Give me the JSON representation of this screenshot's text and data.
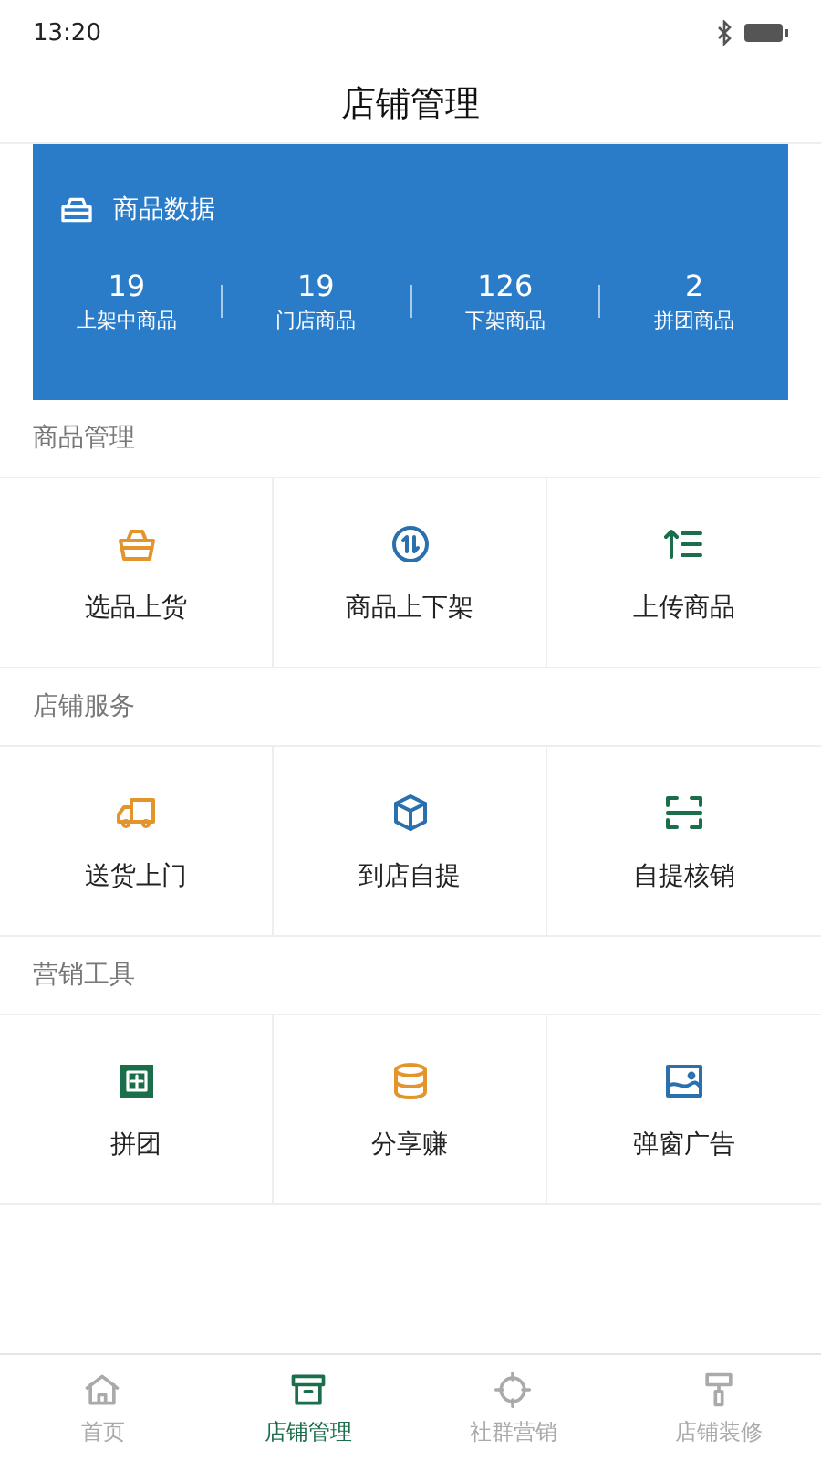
{
  "status_bar": {
    "time": "13:20"
  },
  "header": {
    "title": "店铺管理"
  },
  "stats_card": {
    "title": "商品数据",
    "stats": [
      {
        "value": "19",
        "label": "上架中商品"
      },
      {
        "value": "19",
        "label": "门店商品"
      },
      {
        "value": "126",
        "label": "下架商品"
      },
      {
        "value": "2",
        "label": "拼团商品"
      }
    ]
  },
  "sections": [
    {
      "title": "商品管理",
      "items": [
        {
          "label": "选品上货"
        },
        {
          "label": "商品上下架"
        },
        {
          "label": "上传商品"
        }
      ]
    },
    {
      "title": "店铺服务",
      "items": [
        {
          "label": "送货上门"
        },
        {
          "label": "到店自提"
        },
        {
          "label": "自提核销"
        }
      ]
    },
    {
      "title": "营销工具",
      "items": [
        {
          "label": "拼团"
        },
        {
          "label": "分享赚"
        },
        {
          "label": "弹窗广告"
        }
      ]
    }
  ],
  "tab_bar": [
    {
      "label": "首页",
      "selected": false
    },
    {
      "label": "店铺管理",
      "selected": true
    },
    {
      "label": "社群营销",
      "selected": false
    },
    {
      "label": "店铺装修",
      "selected": false
    }
  ]
}
